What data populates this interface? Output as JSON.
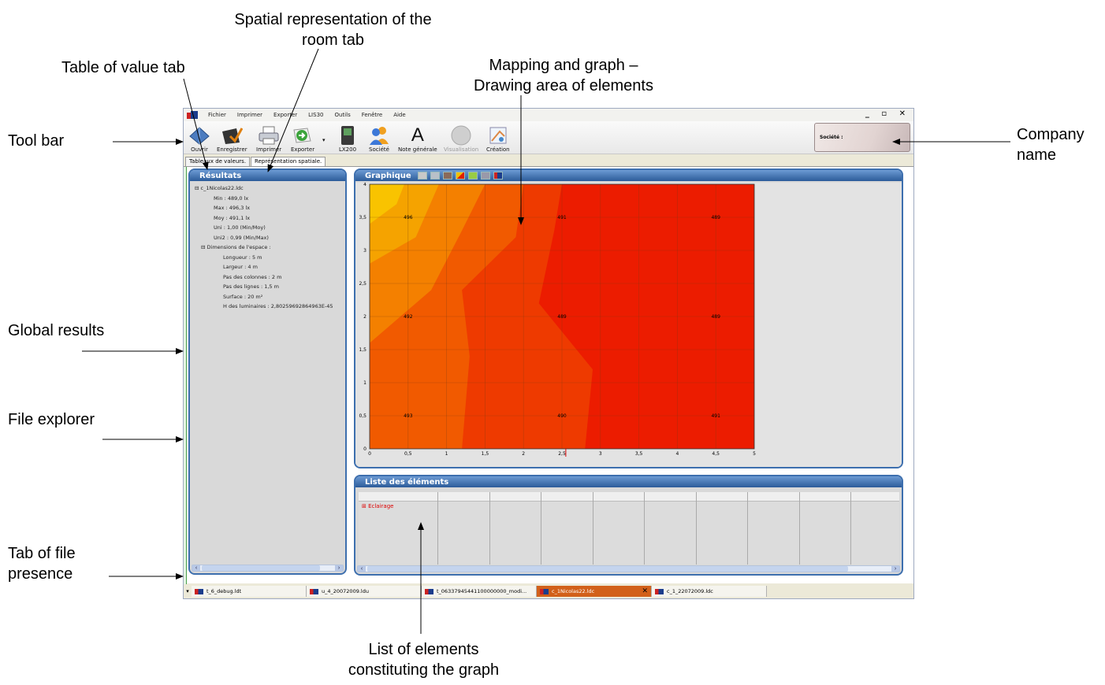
{
  "annotations": {
    "spatial_tab": "Spatial representation of the room tab",
    "table_tab": "Table of value tab",
    "mapping": "Mapping and graph – Drawing area of elements",
    "tool_bar": "Tool bar",
    "company_name": "Company name",
    "global_results": "Global results",
    "file_explorer": "File explorer",
    "tab_file_presence": "Tab of file presence",
    "list_elements": "List of elements constituting the graph"
  },
  "menu": [
    "Fichier",
    "Imprimer",
    "Exporter",
    "LIS30",
    "Outils",
    "Fenêtre",
    "Aide"
  ],
  "window_controls": "_ ▫ ✕",
  "toolbar": {
    "ouvrir": "Ouvrir",
    "enregistrer": "Enregistrer",
    "imprimer": "Imprimer",
    "exporter": "Exporter",
    "lx200": "LX200",
    "societe": "Société",
    "note": "Note générale",
    "visualisation": "Visualisation",
    "creation": "Création",
    "company_label": "Société :"
  },
  "tabs": [
    "Tableaux de valeurs.",
    "Représentation spatiale."
  ],
  "results": {
    "title": "Résultats",
    "file": "c_1Nicolas22.ldc",
    "min": "Min : 489,0 lx",
    "max": "Max : 496,3 lx",
    "moy": "Moy : 491,1 lx",
    "uni": "Uni : 1,00 (Min/Moy)",
    "uni2": "Uni2 : 0,99 (Min/Max)",
    "dims": "Dimensions de l'espace :",
    "longueur": "Longueur : 5 m",
    "largeur": "Largeur : 4 m",
    "pas_col": "Pas des colonnes : 2 m",
    "pas_lig": "Pas des lignes : 1,5 m",
    "surface": "Surface : 20 m²",
    "hlum": "H des luminaires : 2,80259692864963E-45"
  },
  "graph": {
    "title": "Graphique"
  },
  "elements": {
    "title": "Liste des éléments",
    "row": "Eclairage"
  },
  "files": [
    "t_6_debug.ldt",
    "u_4_20072009.ldu",
    "t_06337945441100000000_modi...",
    "c_1Nicolas22.ldc",
    "c_1_22072009.ldc"
  ],
  "chart_data": {
    "type": "heatmap",
    "x_ticks": [
      "0",
      "0,5",
      "1",
      "1,5",
      "2",
      "2,5",
      "3",
      "3,5",
      "4",
      "4,5",
      "5"
    ],
    "y_ticks": [
      "0",
      "0,5",
      "1",
      "1,5",
      "2",
      "2,5",
      "3",
      "3,5",
      "4"
    ],
    "xlim": [
      0,
      5
    ],
    "ylim": [
      0,
      4
    ],
    "points": [
      {
        "x": 0.5,
        "y": 3.5,
        "v": "496"
      },
      {
        "x": 2.5,
        "y": 3.5,
        "v": "491"
      },
      {
        "x": 4.5,
        "y": 3.5,
        "v": "489"
      },
      {
        "x": 0.5,
        "y": 2.0,
        "v": "492"
      },
      {
        "x": 2.5,
        "y": 2.0,
        "v": "489"
      },
      {
        "x": 4.5,
        "y": 2.0,
        "v": "489"
      },
      {
        "x": 0.5,
        "y": 0.5,
        "v": "493"
      },
      {
        "x": 2.5,
        "y": 0.5,
        "v": "490"
      },
      {
        "x": 4.5,
        "y": 0.5,
        "v": "491"
      }
    ],
    "grid": true,
    "colors": [
      "#f9c300",
      "#f5a300",
      "#f48000",
      "#f15a00",
      "#ee3a00",
      "#ec1c00"
    ]
  }
}
